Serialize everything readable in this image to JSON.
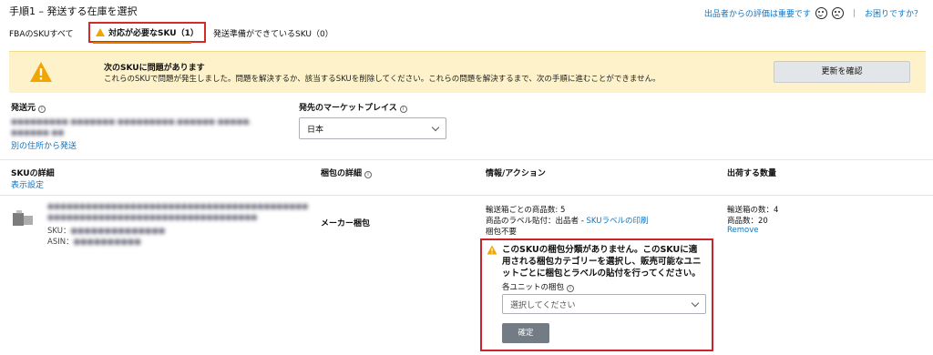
{
  "page": {
    "title": "手順1 – 発送する在庫を選択"
  },
  "header_right": {
    "feedback_text": "出品者からの評価は重要です",
    "separator": "|",
    "help_link": "お困りですか？"
  },
  "tabs": [
    {
      "label": "FBAのSKUすべて"
    },
    {
      "label": "対応が必要なSKU（1）"
    },
    {
      "label": "発送準備ができているSKU（0）"
    }
  ],
  "banner": {
    "heading": "次のSKUに問題があります",
    "message": "これらのSKUで問題が発生しました。問題を解決するか、該当するSKUを削除してください。これらの問題を解決するまで、次の手順に進むことができません。",
    "refresh_button": "更新を確認"
  },
  "ship_from": {
    "label": "発送元",
    "address_line1": "●●●●●●●●● ●●●●●●● ●●●●●●●●●,●●●●●● ●●●●●,",
    "address_line2": "●●●●●● ●●",
    "alt_address_link": "別の住所から発送"
  },
  "marketplace": {
    "label": "発先のマーケットプレイス",
    "selected": "日本"
  },
  "table": {
    "headers": {
      "sku_details": "SKUの詳細",
      "packing": "梱包の詳細",
      "info_action": "情報/アクション",
      "quantity": "出荷する数量"
    },
    "display_settings_link": "表示設定"
  },
  "row": {
    "product_name_line1": "●●●●●●●●●●●●●●●●●●●●●●●●●●●●●●●●●●●●●●●●●",
    "product_name_line2": "●●●●●●●●●●●●●●●●●●●●●●●●●●●●●●●●●",
    "sku_label": "SKU：",
    "sku_value": "●●●●●●●●●●●●●●",
    "asin_label": "ASIN：",
    "asin_value": "●●●●●●●●●●",
    "packing_type": "メーカー梱包",
    "units_per_box": "輸送箱ごとの商品数: 5",
    "label_owner_prefix": "商品のラベル貼付：出品者 - ",
    "label_print_link": "SKUラベルの印刷",
    "prep_none": "梱包不要",
    "box_count": "輸送箱の数：4",
    "unit_count": "商品数：20",
    "remove_link": "Remove"
  },
  "prep_alert": {
    "message_line1": "このSKUの梱包分類がありません。このSKUに適",
    "message_line2": "用される梱包カテゴリーを選択し、販売可能なユニ",
    "message_line3": "ットごとに梱包とラベルの貼付を行ってください。",
    "field_label": "各ユニットの梱包",
    "select_placeholder": "選択してください",
    "confirm_button": "確定"
  },
  "colors": {
    "accent_red": "#c9262c",
    "link_blue": "#0f74c0",
    "warning_amber": "#f0a500",
    "banner_bg": "#fdf2c9"
  }
}
